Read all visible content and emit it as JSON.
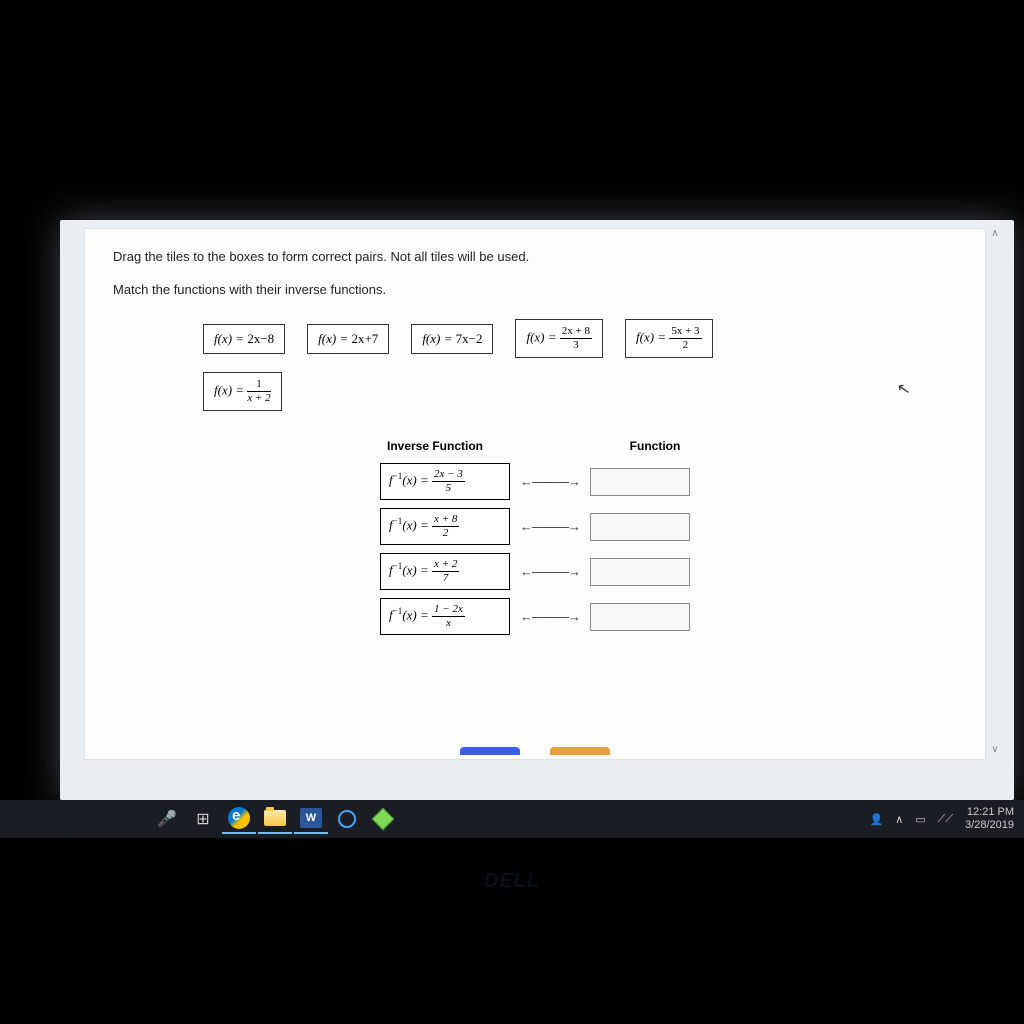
{
  "instructions": {
    "line1": "Drag the tiles to the boxes to form correct pairs. Not all tiles will be used.",
    "line2": "Match the functions with their inverse functions."
  },
  "tiles": {
    "t1_lhs": "f(x) = ",
    "t1_rhs": "2x−8",
    "t2_lhs": "f(x) = ",
    "t2_rhs": "2x+7",
    "t3_lhs": "f(x) = ",
    "t3_rhs": "7x−2",
    "t4_lhs": "f(x) = ",
    "t4_num": "2x + 8",
    "t4_den": "3",
    "t5_lhs": "f(x) = ",
    "t5_num": "5x + 3",
    "t5_den": "2",
    "t6_lhs": "f(x) = ",
    "t6_num": "1",
    "t6_den": "x + 2"
  },
  "headers": {
    "inverse": "Inverse Function",
    "function": "Function"
  },
  "inverses": {
    "i1_lhs": "f",
    "i1_sup": "−1",
    "i1_mid": "(x) = ",
    "i1_num": "2x − 3",
    "i1_den": "5",
    "i2_lhs": "f",
    "i2_sup": "−1",
    "i2_mid": "(x) = ",
    "i2_num": "x + 8",
    "i2_den": "2",
    "i3_lhs": "f",
    "i3_sup": "−1",
    "i3_mid": "(x) = ",
    "i3_num": "x + 2",
    "i3_den": "7",
    "i4_lhs": "f",
    "i4_sup": "−1",
    "i4_mid": "(x) = ",
    "i4_num": "1 − 2x",
    "i4_den": "x"
  },
  "arrow": "←———→",
  "taskbar": {
    "time": "12:21 PM",
    "date": "3/28/2019",
    "word_label": "W"
  },
  "logo": "DELL"
}
